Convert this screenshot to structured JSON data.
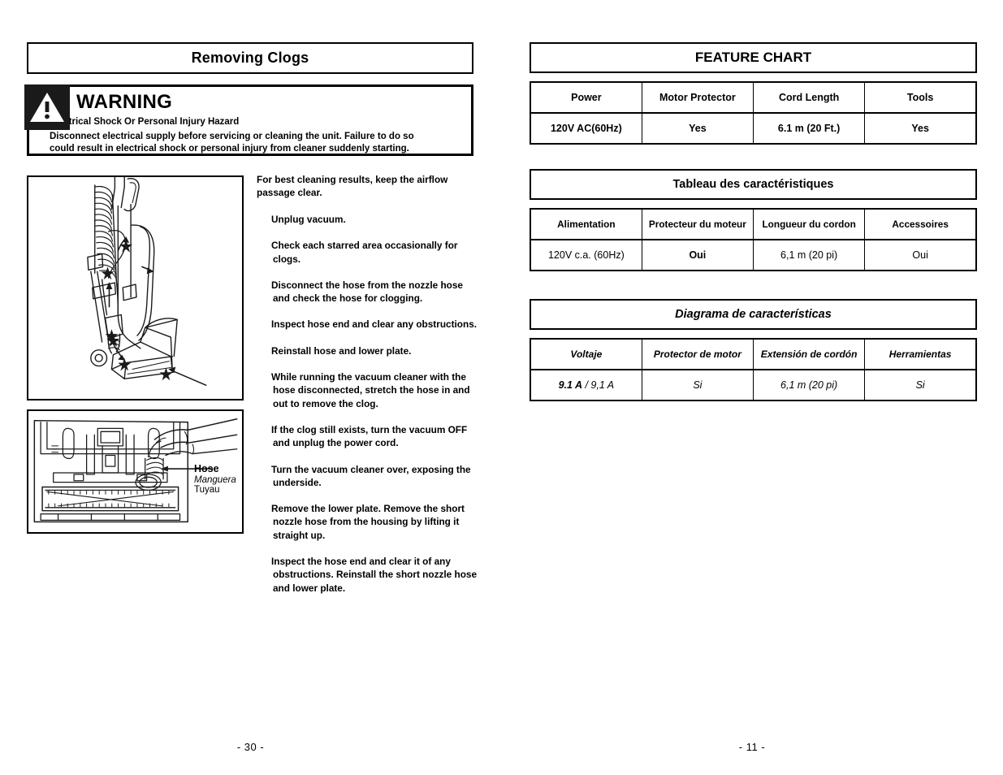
{
  "left_page": {
    "section_title": "Removing Clogs",
    "warning": {
      "word": "WARNING",
      "icon": "warning-triangle-icon",
      "hazard_line": "Electrical Shock Or Personal Injury Hazard",
      "body_line_1": "Disconnect electrical supply before servicing or cleaning the unit. Failure to do so",
      "body_line_2": "could result in electrical shock or personal injury from cleaner suddenly starting."
    },
    "illustrations": {
      "upper": "upright-vacuum-cleaner-side-view-with-starred-clog-areas",
      "lower": "vacuum-cleaner-underside-with-hand-holding-hose"
    },
    "callout": {
      "english": "Hose",
      "spanish": "Manguera",
      "french": "Tuyau"
    },
    "instructions": {
      "intro": "For best cleaning results, keep the airflow passage clear.",
      "steps": [
        "Unplug vacuum.",
        "Check each starred area occasionally for clogs.",
        "Disconnect the hose from the nozzle hose and check the hose for clogging.",
        "Inspect hose end and clear any obstructions.",
        "Reinstall hose and lower plate.",
        "While running the vacuum cleaner with the hose disconnected, stretch the hose in and out to remove the clog.",
        "If the clog still exists, turn the vacuum OFF and unplug the power cord.",
        "Turn the vacuum cleaner over, exposing the underside.",
        "Remove the lower plate.  Remove the short nozzle hose from the housing by lifting it straight up.",
        "Inspect the hose end and clear it of any obstructions.  Reinstall the short nozzle hose and lower plate."
      ]
    },
    "page_number": "- 30 -"
  },
  "right_page": {
    "charts": [
      {
        "id": "english",
        "heading": "FEATURE CHART",
        "headers": [
          "Power",
          "Motor Protector",
          "Cord Length",
          "Tools"
        ],
        "values": [
          "120V AC(60Hz)",
          "Yes",
          "6.1 m (20 Ft.)",
          "Yes"
        ]
      },
      {
        "id": "french",
        "heading": "Tableau des caractéristiques",
        "headers": [
          "Alimentation",
          "Protecteur du moteur",
          "Longueur du cordon",
          "Accessoires"
        ],
        "values": [
          "120V c.a. (60Hz)",
          "Oui",
          "6,1 m (20 pi)",
          "Oui"
        ]
      },
      {
        "id": "spanish",
        "heading": "Diagrama de características",
        "headers": [
          "Voltaje",
          "Protector de motor",
          "Extensión de cordón",
          "Herramientas"
        ],
        "values": [
          "9.1 A / 9,1 A",
          "Si",
          "6,1 m (20 pi)",
          "Si"
        ],
        "voltage_bold_part": "9.1 A",
        "voltage_rest_part": " / 9,1 A"
      }
    ],
    "page_number": "- 11 -"
  }
}
